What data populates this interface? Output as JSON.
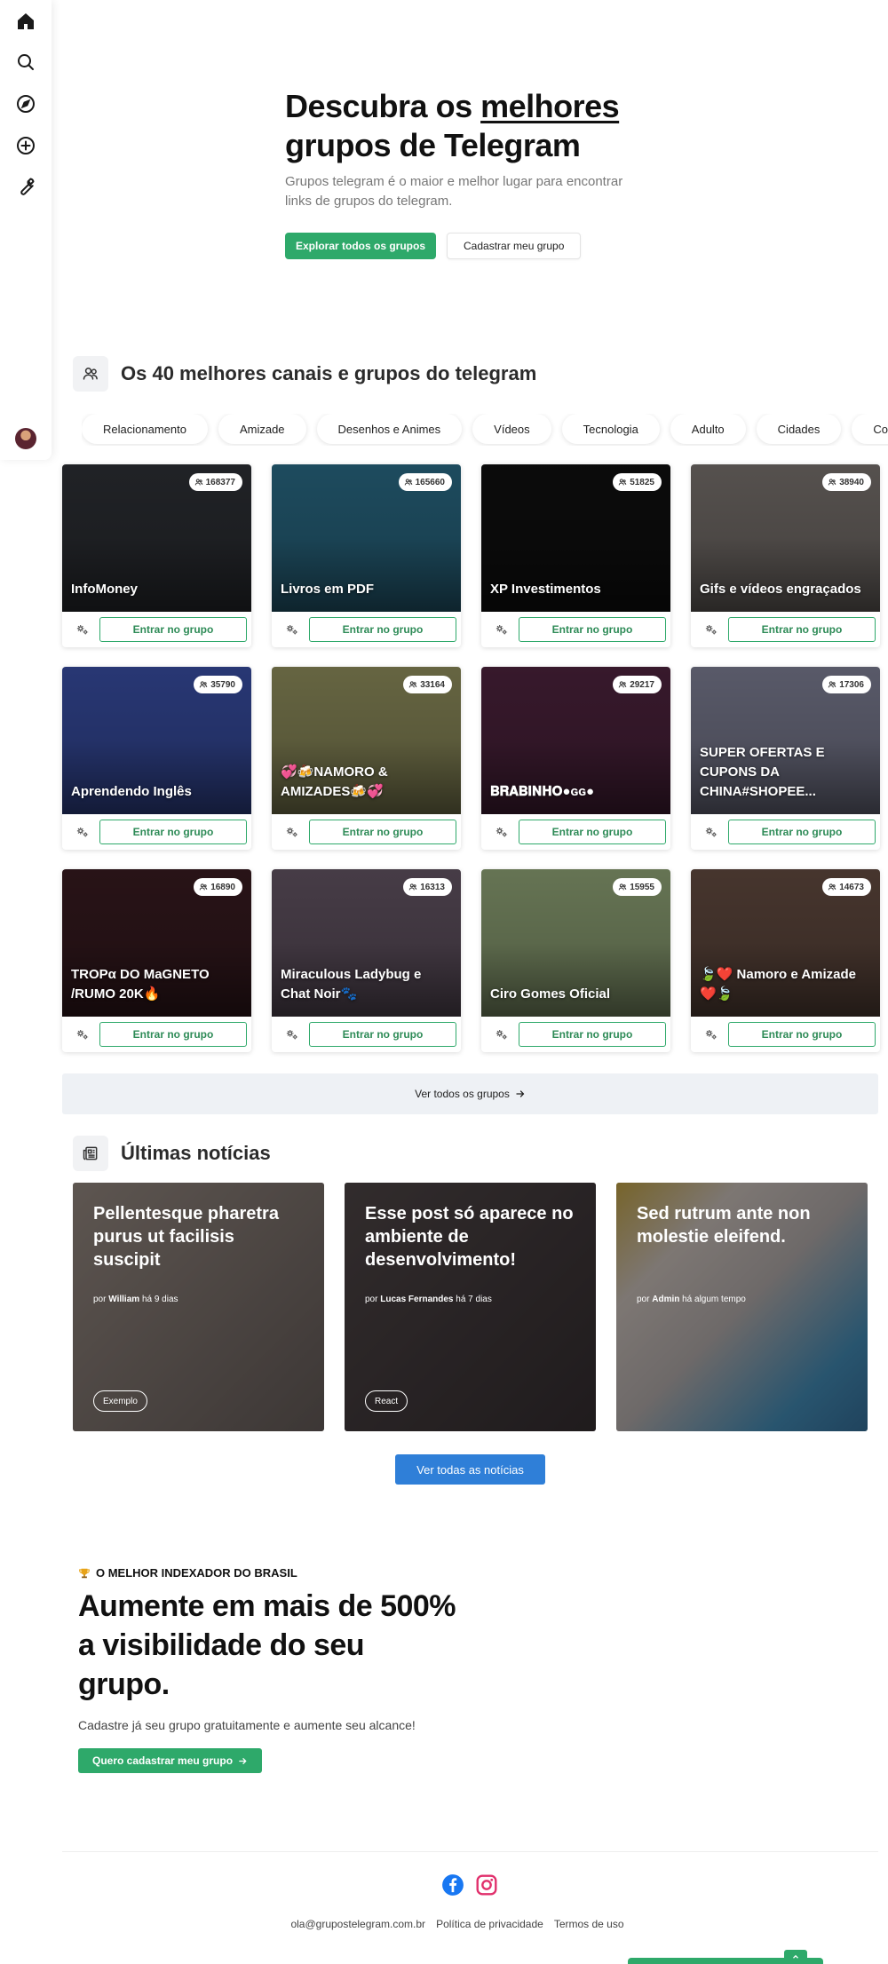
{
  "hero": {
    "title_part1": "Descubra os ",
    "title_underlined": "melhores",
    "title_part2": "grupos de Telegram",
    "subtitle": "Grupos telegram é o maior e melhor lugar para encontrar links de grupos do telegram.",
    "explore_btn": "Explorar todos os grupos",
    "register_btn": "Cadastrar meu grupo"
  },
  "groups_section": {
    "title": "Os 40 melhores canais e grupos do telegram",
    "categories": [
      "Relacionamento",
      "Amizade",
      "Desenhos e Animes",
      "Vídeos",
      "Tecnologia",
      "Adulto",
      "Cidades",
      "Compr"
    ],
    "join_label": "Entrar no grupo",
    "groups": [
      {
        "name": "InfoMoney",
        "members": "168377",
        "bg": "#222428"
      },
      {
        "name": "Livros em PDF",
        "members": "165660",
        "bg": "#1f4f63"
      },
      {
        "name": "XP Investimentos",
        "members": "51825",
        "bg": "#0c0c0c"
      },
      {
        "name": "Gifs e vídeos engraçados",
        "members": "38940",
        "bg": "#5a5552"
      },
      {
        "name": "Aprendendo Inglês",
        "members": "35790",
        "bg": "#2a3a7a"
      },
      {
        "name": "💞🍻NAMORO & AMIZADES🍻💞",
        "members": "33164",
        "bg": "#6b6a45"
      },
      {
        "name": "𝐁𝐑𝐀𝐁𝐈𝐍𝐇𝐎●ɢɢ●",
        "members": "29217",
        "bg": "#3a1a2e"
      },
      {
        "name": "SUPER OFERTAS E CUPONS DA CHINA#SHOPEE...",
        "members": "17306",
        "bg": "#5d5e6e"
      },
      {
        "name": "TROPα DO MaGNETO /RUMO 20K🔥",
        "members": "16890",
        "bg": "#2a1418"
      },
      {
        "name": "Miraculous Ladybug e Chat Noir🐾",
        "members": "16313",
        "bg": "#4a3f4a"
      },
      {
        "name": "Ciro Gomes Oficial",
        "members": "15955",
        "bg": "#6b7a58"
      },
      {
        "name": "🍃❤️ Namoro e Amizade ❤️🍃",
        "members": "14673",
        "bg": "#4a3830"
      }
    ],
    "see_all": "Ver todos os grupos"
  },
  "news_section": {
    "title": "Últimas notícias",
    "posts": [
      {
        "title": "Pellentesque pharetra purus ut facilisis suscipit",
        "by": "por",
        "author": "William",
        "time": "há 9 dias",
        "tag": "Exemplo",
        "bg": "#8a7a68"
      },
      {
        "title": "Esse post só aparece no ambiente de desenvolvimento!",
        "by": "por",
        "author": "Lucas Fernandes",
        "time": "há 7 dias",
        "tag": "React",
        "bg": "#3a3028"
      },
      {
        "title": "Sed rutrum ante non molestie eleifend.",
        "by": "por",
        "author": "Admin",
        "time": "há algum tempo",
        "tag": "",
        "bg": "#4a8aa0"
      }
    ],
    "see_all": "Ver todas as notícias"
  },
  "cta": {
    "kicker": "O MELHOR INDEXADOR DO BRASIL",
    "title": "Aumente em mais de 500% a visibilidade do seu grupo.",
    "text": "Cadastre já seu grupo gratuitamente e aumente seu alcance!",
    "button": "Quero cadastrar meu grupo"
  },
  "footer": {
    "email": "ola@grupostelegram.com.br",
    "privacy": "Política de privacidade",
    "terms": "Termos de uso"
  },
  "colors": {
    "green": "#2ea96a",
    "blue": "#2f7fd8",
    "facebook": "#1877f2",
    "instagram": "#e1306c"
  }
}
